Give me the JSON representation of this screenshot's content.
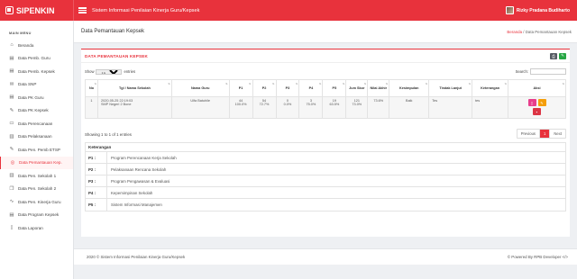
{
  "brand": {
    "name": "SIPENKIN"
  },
  "topbar": {
    "title": "Sistem Informasi Penilaian Kinerja Guru/Kepsek",
    "user_name": "Rizky Pradana Budiharto"
  },
  "sidebar": {
    "header": "MAIN MENU",
    "items": [
      {
        "label": "Beranda",
        "icon": "home-icon",
        "glyph": "⌂"
      },
      {
        "label": "Data Pemb. Guru",
        "icon": "document-icon",
        "glyph": "▤"
      },
      {
        "label": "Data Pemb. Kepsek",
        "icon": "document-icon",
        "glyph": "▤"
      },
      {
        "label": "Data SNP",
        "icon": "mail-icon",
        "glyph": "✉"
      },
      {
        "label": "Data PK Guru",
        "icon": "document-icon",
        "glyph": "▤"
      },
      {
        "label": "Data PK Kepsek",
        "icon": "pencil-icon",
        "glyph": "✎"
      },
      {
        "label": "Data Perencanaan",
        "icon": "monitor-icon",
        "glyph": "▭"
      },
      {
        "label": "Data Pelaksanaan",
        "icon": "bar-chart-icon",
        "glyph": "▥"
      },
      {
        "label": "Data Pen. Pemb ETSP",
        "icon": "pencil-icon",
        "glyph": "✎"
      },
      {
        "label": "Data Pemantauan Kep.",
        "icon": "target-icon",
        "glyph": "◎"
      },
      {
        "label": "Data Pen. Sekolah 1",
        "icon": "bar-chart-icon",
        "glyph": "▥"
      },
      {
        "label": "Data Pen. Sekolah 2",
        "icon": "copy-icon",
        "glyph": "❐"
      },
      {
        "label": "Data Pen. Kinerja Guru",
        "icon": "pulse-icon",
        "glyph": "∿"
      },
      {
        "label": "Data Program Kepsek",
        "icon": "document-icon",
        "glyph": "▤"
      },
      {
        "label": "Data Laporan",
        "icon": "book-icon",
        "glyph": "▯"
      }
    ]
  },
  "page": {
    "title": "Data Pemantauan Kepsek",
    "breadcrumb": {
      "home": "Beranda",
      "separator": "/",
      "current": "Data Pemantauan Kepsek"
    }
  },
  "card": {
    "title": "DATA PEMANTAUAN KEPSEK",
    "show_label": "Show",
    "entries_value": "10",
    "entries_label": "entries",
    "search_label": "Search:",
    "search_value": ""
  },
  "table": {
    "headers": [
      "No",
      "Tgl / Nama Sekolah",
      "Nama Guru",
      "P1",
      "P2",
      "P3",
      "P4",
      "P5",
      "Jum Skor",
      "Nilai Akhir",
      "Kesimpulan",
      "Tindak Lanjut",
      "Keterangan",
      "Aksi"
    ],
    "row": {
      "no": "1",
      "tgl": "2020-05-25 22:19:03",
      "sekolah": "SMP Negeri 2 Bone",
      "guru": "Ulfa Batuhile",
      "p1a": "44",
      "p1b": "100.0%",
      "p2a": "54",
      "p2b": "72.7%",
      "p3a": "0",
      "p3b": "0.0%",
      "p4a": "3",
      "p4b": "75.0%",
      "p5a": "19",
      "p5b": "63.5%",
      "jum_a": "121",
      "jum_b": "73.0%",
      "nilai": "73.6%",
      "kesimpulan": "Baik",
      "tindak": "Tes",
      "keterangan": "tes"
    }
  },
  "info": "Showing 1 to 1 of 1 entries",
  "pager": {
    "prev": "Previous",
    "current": "1",
    "next": "Next"
  },
  "keterangan": {
    "title": "Keterangan",
    "rows": [
      {
        "key": "P1 :",
        "value": "Program Perencanaan Kerja Sekolah"
      },
      {
        "key": "P2 :",
        "value": "Pelaksanaan Rencana Sekolah"
      },
      {
        "key": "P3 :",
        "value": "Program Pengawasan & Evaluasi"
      },
      {
        "key": "P4 :",
        "value": "Kepemimpinan Sekolah"
      },
      {
        "key": "P5 :",
        "value": "Sistem Informasi Manajemen"
      }
    ]
  },
  "footer": {
    "left": "2020 © Sistem Informasi Penilaian Kinerja Guru/Kepsek",
    "right": "© Powered By RPB Developer </>"
  },
  "colors": {
    "accent": "#e8323c",
    "print": "#555b63",
    "excel": "#28a745",
    "view": "#e83e8c",
    "edit": "#f59e0b",
    "delete": "#dc3545"
  }
}
